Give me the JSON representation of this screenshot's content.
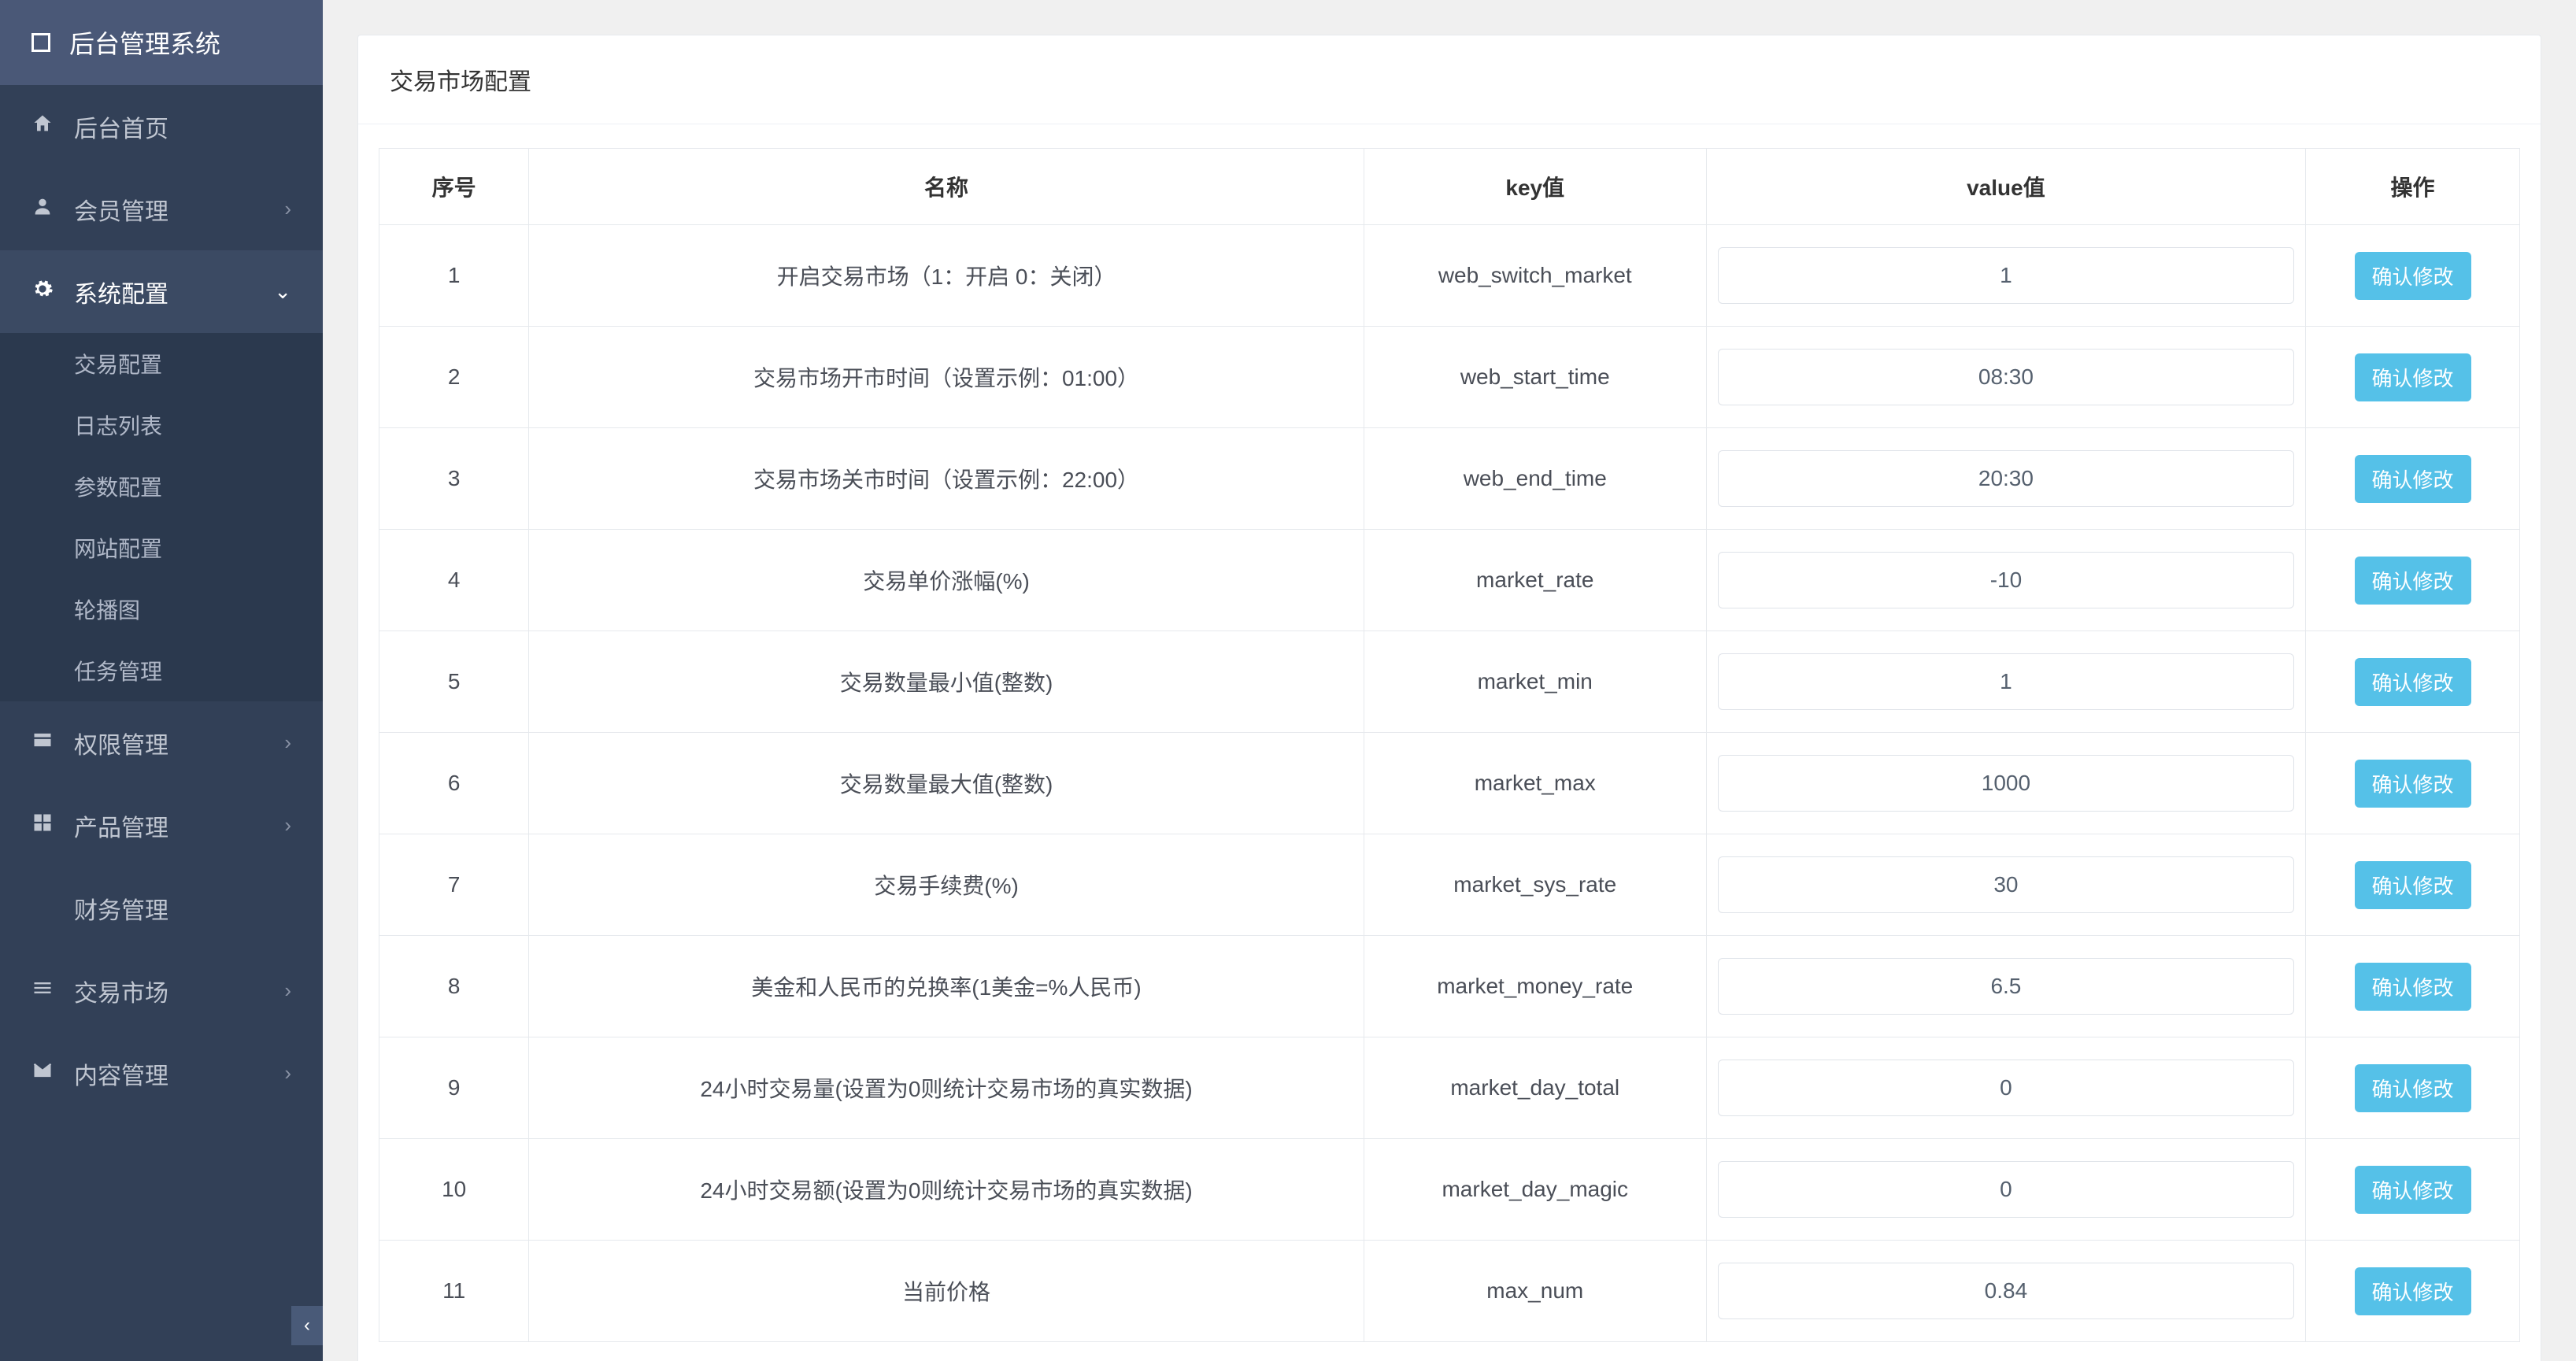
{
  "app": {
    "title": "后台管理系统"
  },
  "sidebar": {
    "items": [
      {
        "icon": "home",
        "label": "后台首页",
        "expandable": false
      },
      {
        "icon": "user",
        "label": "会员管理",
        "expandable": true,
        "expanded": false
      },
      {
        "icon": "gear",
        "label": "系统配置",
        "expandable": true,
        "expanded": true,
        "children": [
          {
            "label": "交易配置"
          },
          {
            "label": "日志列表"
          },
          {
            "label": "参数配置"
          },
          {
            "label": "网站配置"
          },
          {
            "label": "轮播图"
          },
          {
            "label": "任务管理"
          }
        ]
      },
      {
        "icon": "card",
        "label": "权限管理",
        "expandable": true,
        "expanded": false
      },
      {
        "icon": "grid",
        "label": "产品管理",
        "expandable": true,
        "expanded": false
      },
      {
        "icon": "blank",
        "label": "财务管理",
        "expandable": false
      },
      {
        "icon": "bars",
        "label": "交易市场",
        "expandable": true,
        "expanded": false
      },
      {
        "icon": "mail",
        "label": "内容管理",
        "expandable": true,
        "expanded": false
      }
    ]
  },
  "panel": {
    "title": "交易市场配置"
  },
  "table": {
    "headers": {
      "index": "序号",
      "name": "名称",
      "key": "key值",
      "value": "value值",
      "action": "操作"
    },
    "action_label": "确认修改",
    "rows": [
      {
        "index": "1",
        "name": "开启交易市场（1：开启 0：关闭）",
        "key": "web_switch_market",
        "value": "1"
      },
      {
        "index": "2",
        "name": "交易市场开市时间（设置示例：01:00）",
        "key": "web_start_time",
        "value": "08:30"
      },
      {
        "index": "3",
        "name": "交易市场关市时间（设置示例：22:00）",
        "key": "web_end_time",
        "value": "20:30"
      },
      {
        "index": "4",
        "name": "交易单价涨幅(%)",
        "key": "market_rate",
        "value": "-10"
      },
      {
        "index": "5",
        "name": "交易数量最小值(整数)",
        "key": "market_min",
        "value": "1"
      },
      {
        "index": "6",
        "name": "交易数量最大值(整数)",
        "key": "market_max",
        "value": "1000"
      },
      {
        "index": "7",
        "name": "交易手续费(%)",
        "key": "market_sys_rate",
        "value": "30"
      },
      {
        "index": "8",
        "name": "美金和人民币的兑换率(1美金=%人民币)",
        "key": "market_money_rate",
        "value": "6.5"
      },
      {
        "index": "9",
        "name": "24小时交易量(设置为0则统计交易市场的真实数据)",
        "key": "market_day_total",
        "value": "0"
      },
      {
        "index": "10",
        "name": "24小时交易额(设置为0则统计交易市场的真实数据)",
        "key": "market_day_magic",
        "value": "0"
      },
      {
        "index": "11",
        "name": "当前价格",
        "key": "max_num",
        "value": "0.84"
      }
    ]
  }
}
